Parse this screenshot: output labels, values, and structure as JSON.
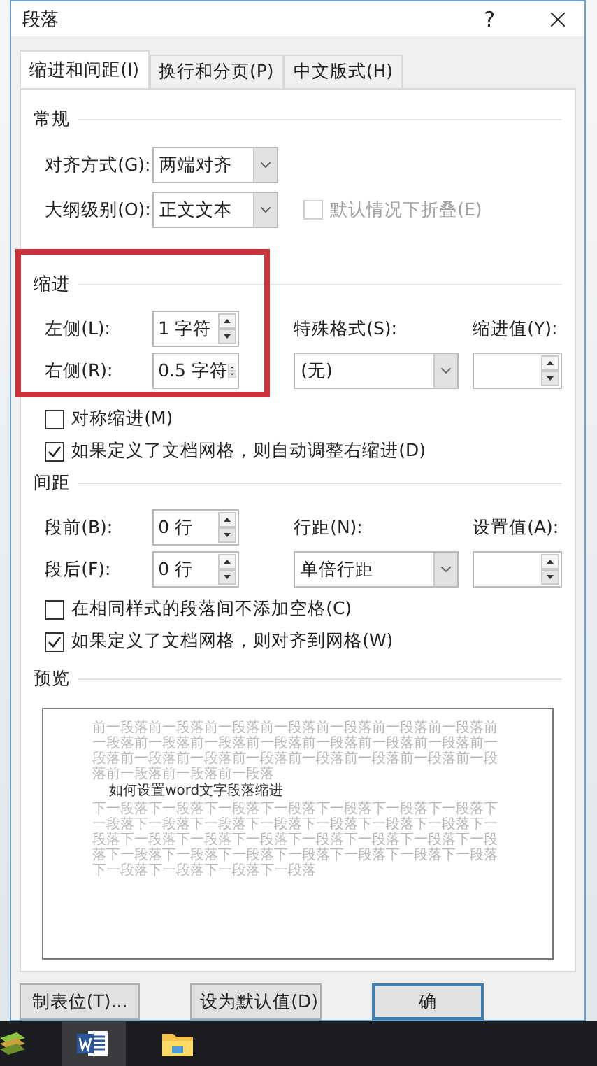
{
  "window": {
    "title": "段落",
    "help": "?"
  },
  "tabs": [
    {
      "label": "缩进和间距(I)",
      "selected": true
    },
    {
      "label": "换行和分页(P)",
      "selected": false
    },
    {
      "label": "中文版式(H)",
      "selected": false
    }
  ],
  "general": {
    "heading": "常规",
    "fields": [
      {
        "label": "对齐方式(G):",
        "value": "两端对齐"
      },
      {
        "label": "大纲级别(O):",
        "value": "正文文本"
      }
    ],
    "collapse": {
      "label": "默认情况下折叠(E)",
      "checked": false,
      "disabled": true
    }
  },
  "indent": {
    "heading": "缩进",
    "highlighted": true,
    "left": {
      "label": "左侧(L):",
      "value": "1 字符"
    },
    "right": {
      "label": "右侧(R):",
      "value": "0.5 字符"
    },
    "special": {
      "label": "特殊格式(S):",
      "value": "(无)"
    },
    "by": {
      "label": "缩进值(Y):"
    },
    "checks": [
      {
        "label": "对称缩进(M)",
        "checked": false
      },
      {
        "label": "如果定义了文档网格，则自动调整右缩进(D)",
        "checked": true
      }
    ]
  },
  "spacing": {
    "heading": "间距",
    "before": {
      "label": "段前(B):",
      "value": "0 行"
    },
    "after": {
      "label": "段后(F):",
      "value": "0 行"
    },
    "line": {
      "label": "行距(N):",
      "value": "单倍行距"
    },
    "at": {
      "label": "设置值(A):"
    },
    "checks": [
      {
        "label": "在相同样式的段落间不添加空格(C)",
        "checked": false
      },
      {
        "label": "如果定义了文档网格，则对齐到网格(W)",
        "checked": true
      }
    ]
  },
  "preview": {
    "heading": "预览",
    "previous": "前一段落前一段落前一段落前一段落前一段落前一段落前一段落前一段落前一段落前一段落前一段落前一段落前一段落前一段落前一段落前一段落前一段落前一段落前一段落前一段落前一段落前一段落前一段落前一段落前一段落",
    "sample": "如何设置word文字段落缩进",
    "next": "下一段落下一段落下一段落下一段落下一段落下一段落下一段落下一段落下一段落下一段落下一段落下一段落下一段落下一段落下一段落下一段落下一段落下一段落下一段落下一段落下一段落下一段落下一段落下一段落下一段落下一段落下一段落下一段落下一段落下一段落下一段落下一段落下一段落"
  },
  "buttons": [
    {
      "label": "制表位(T)...",
      "default": false
    },
    {
      "label": "设为默认值(D)",
      "default": false
    },
    {
      "label": "确",
      "default": true
    }
  ]
}
